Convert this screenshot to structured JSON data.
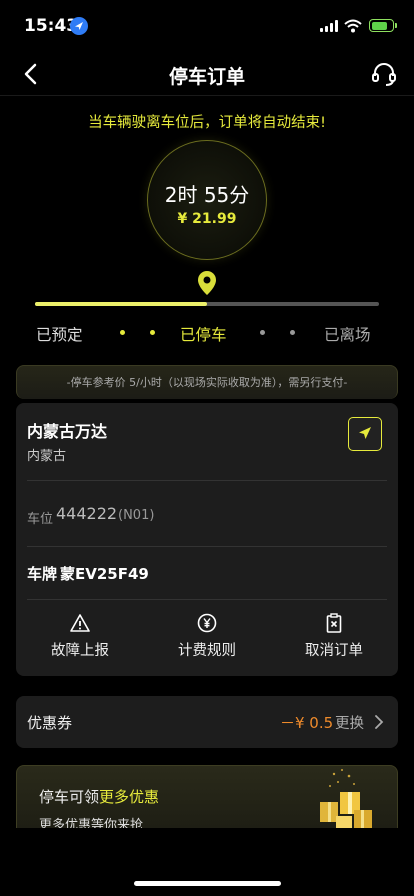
{
  "status_bar": {
    "time": "15:43"
  },
  "nav": {
    "title": "停车订单"
  },
  "notice": "当车辆驶离车位后，订单将自动结束!",
  "timer": {
    "duration": "2时 55分",
    "amount": "¥ 21.99"
  },
  "progress": {
    "fraction": 0.5
  },
  "stages": [
    "已预定",
    "已停车",
    "已离场"
  ],
  "price_note": "-停车参考价 5/小时（以现场实际收取为准），需另行支付-",
  "lot": {
    "name": "内蒙古万达",
    "region": "内蒙古",
    "space_label": "车位",
    "space_number": "444222",
    "space_code": "(N01)",
    "plate_label": "车牌",
    "plate_value": "蒙EV25F49"
  },
  "actions": [
    {
      "label": "故障上报",
      "icon": "warning-icon"
    },
    {
      "label": "计费规则",
      "icon": "yen-coin-icon"
    },
    {
      "label": "取消订单",
      "icon": "cancel-clipboard-icon"
    }
  ],
  "coupon": {
    "label": "优惠券",
    "value": "－¥ 0.5",
    "change": "更换"
  },
  "promo": {
    "title_prefix": "停车可领",
    "title_highlight": "更多优惠",
    "subtitle": "更多优惠等你来抢"
  },
  "colors": {
    "accent": "#e6ea3c",
    "discount": "#ee8a2b",
    "card": "#1d1d1d",
    "background": "#000000"
  }
}
